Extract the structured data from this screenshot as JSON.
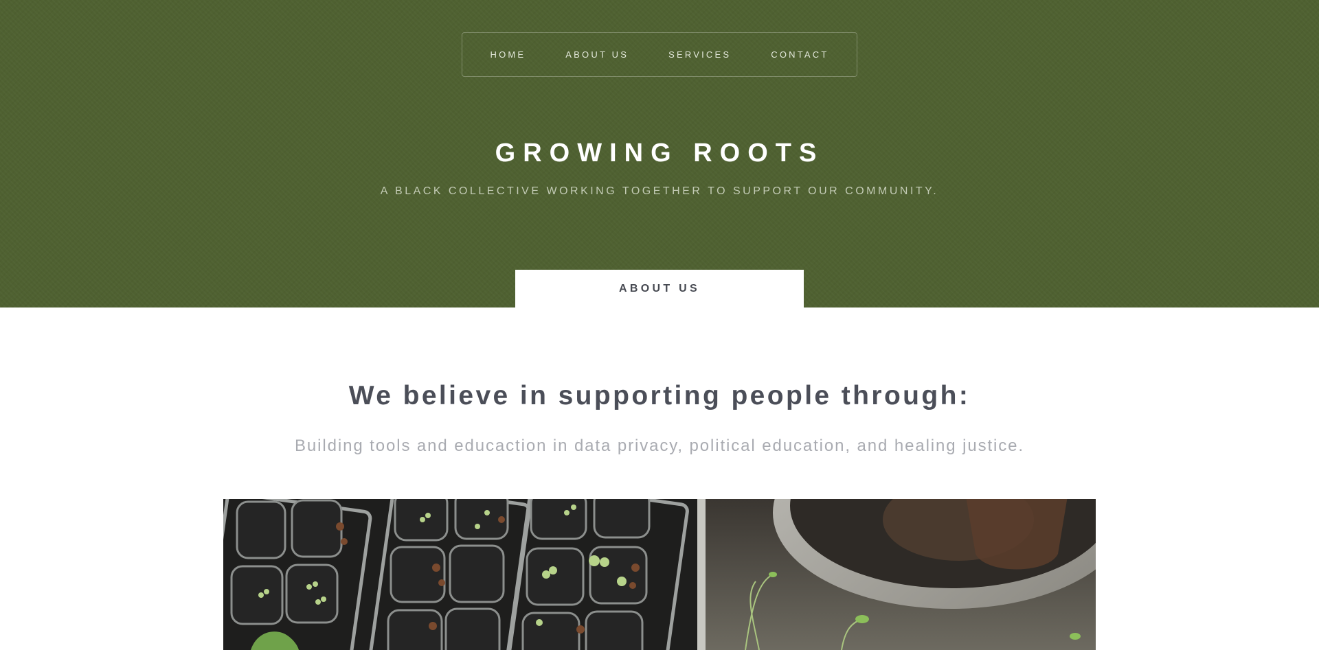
{
  "nav": {
    "items": [
      {
        "label": "HOME"
      },
      {
        "label": "ABOUT US"
      },
      {
        "label": "SERVICES"
      },
      {
        "label": "CONTACT"
      }
    ]
  },
  "hero": {
    "title": "GROWING ROOTS",
    "subtitle": "A BLACK COLLECTIVE WORKING TOGETHER TO SUPPORT OUR COMMUNITY.",
    "button_label": "ABOUT US"
  },
  "intro": {
    "heading": "We believe in supporting people through:",
    "text": "Building tools and educaction in data privacy, political education, and healing justice."
  },
  "colors": {
    "hero_background": "#4f6131",
    "heading_text": "#4b4e58",
    "muted_text": "#a9abb1"
  },
  "image": {
    "subject": "seedling-trays-photo"
  }
}
